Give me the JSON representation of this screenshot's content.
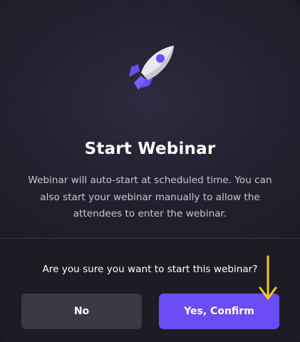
{
  "dialog": {
    "title": "Start Webinar",
    "description": "Webinar will auto-start at scheduled time. You can also start your webinar manually to allow the attendees to enter the webinar.",
    "icon": "rocket-icon",
    "question": "Are you sure you want to start this webinar?",
    "buttons": {
      "no_label": "No",
      "confirm_label": "Yes, Confirm"
    },
    "annotation_icon": "arrow-down-icon"
  },
  "colors": {
    "background": "#232231",
    "footer_background": "#1d1c25",
    "confirm_button": "#6c4cf6",
    "no_button": "#3a3945",
    "rocket_accent": "#6c4cf6",
    "annotation_arrow": "#f2c62c"
  }
}
